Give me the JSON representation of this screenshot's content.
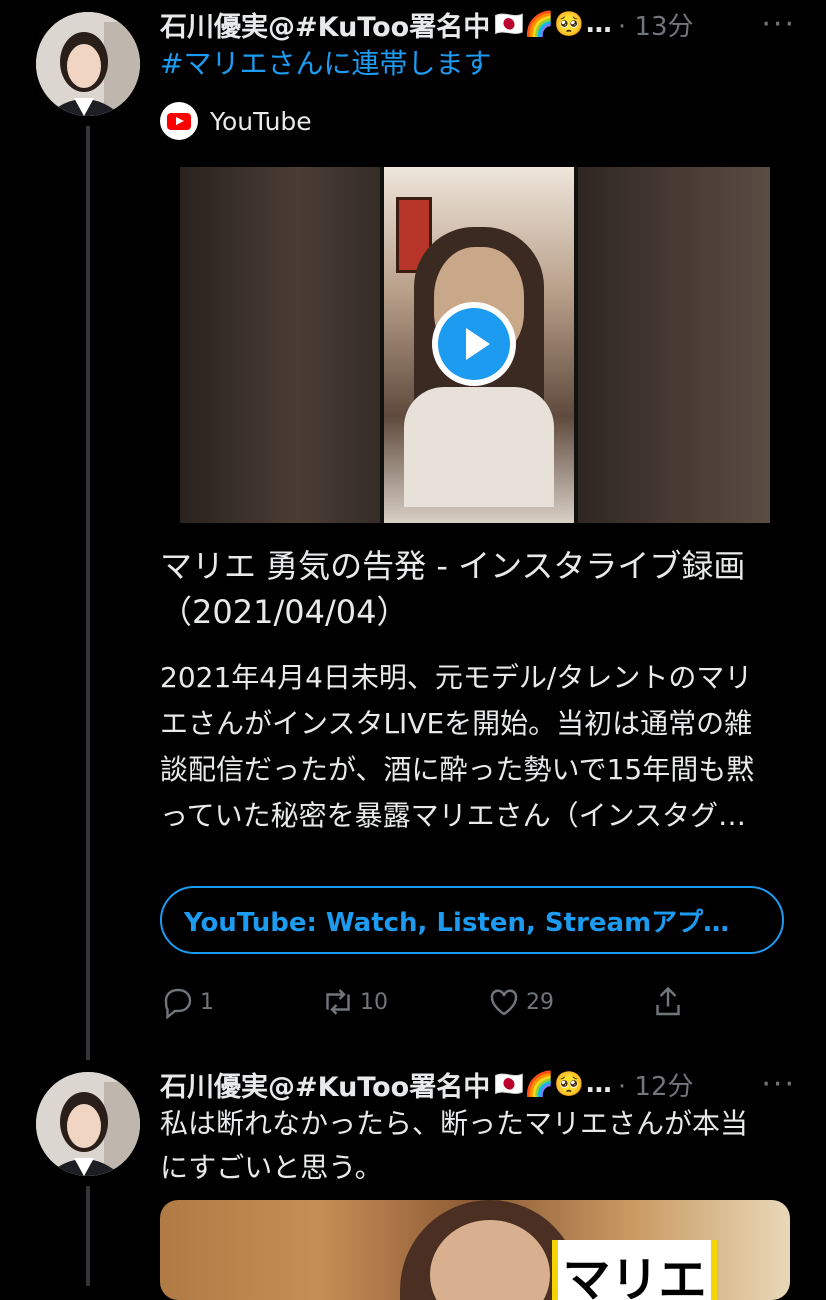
{
  "tweet1": {
    "author": "石川優実@#KuToo署名中",
    "emojis": "🇯🇵🌈🥺",
    "ellipsis": "…",
    "time": "· 13分",
    "more": "···",
    "hashtag_text": "#マリエさんに連帯します",
    "card": {
      "source": "YouTube",
      "title": "マリエ 勇気の告発 - インスタライブ録画（2021/04/04）",
      "description": "2021年4月4日未明、元モデル/タレントのマリエさんがインスタLIVEを開始。当初は通常の雑談配信だったが、酒に酔った勢いで15年間も黙っていた秘密を暴露マリエさん（インスタグ…",
      "app_button": "YouTube: Watch, Listen, Streamアプ…"
    },
    "actions": {
      "reply_count": "1",
      "retweet_count": "10",
      "like_count": "29"
    }
  },
  "tweet2": {
    "author": "石川優実@#KuToo署名中",
    "emojis": "🇯🇵🌈🥺",
    "ellipsis": "…",
    "time": "· 12分",
    "more": "···",
    "text": "私は断れなかったら、断ったマリエさんが本当にすごいと思う。",
    "photo_label": "マリエ"
  },
  "colors": {
    "background": "#000000",
    "text": "#e7e9ea",
    "accent": "#1d9bf0",
    "muted": "#71767b"
  },
  "icons": [
    "reply-icon",
    "retweet-icon",
    "like-icon",
    "share-icon",
    "play-icon",
    "youtube-icon",
    "more-icon"
  ]
}
